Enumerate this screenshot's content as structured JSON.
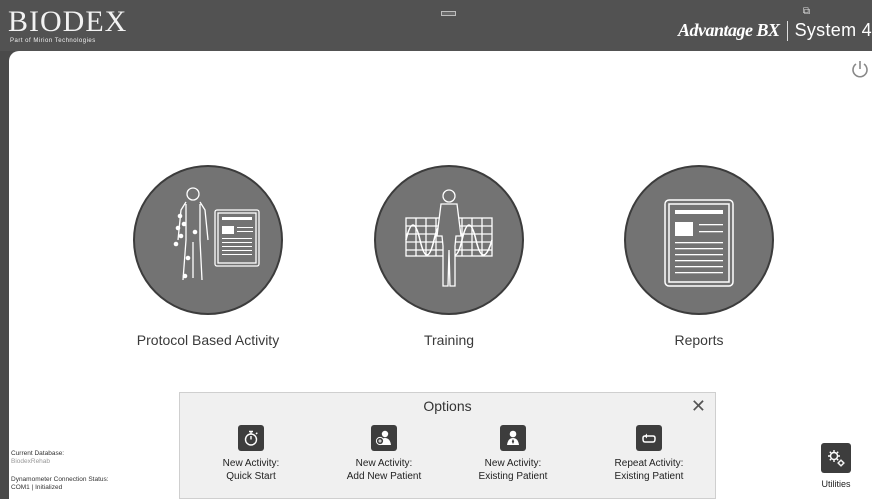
{
  "header": {
    "logo_main": "BIODEX",
    "logo_sub": "Part of Mirion Technologies",
    "brand": "Advantage BX",
    "system": "System 4"
  },
  "activities": [
    {
      "label": "Protocol Based Activity",
      "icon": "protocol-figure-icon"
    },
    {
      "label": "Training",
      "icon": "training-figure-icon"
    },
    {
      "label": "Reports",
      "icon": "report-document-icon"
    }
  ],
  "options": {
    "title": "Options",
    "items": [
      {
        "line1": "New Activity:",
        "line2": "Quick Start",
        "icon": "stopwatch-icon"
      },
      {
        "line1": "New Activity:",
        "line2": "Add New Patient",
        "icon": "add-patient-icon"
      },
      {
        "line1": "New Activity:",
        "line2": "Existing Patient",
        "icon": "patient-icon"
      },
      {
        "line1": "Repeat Activity:",
        "line2": "Existing Patient",
        "icon": "repeat-icon"
      }
    ]
  },
  "status": {
    "db_label": "Current Database:",
    "db_value": "BiodexRehab",
    "conn_label": "Dynamometer Connection Status:",
    "conn_value": "COM1 | Initialized"
  },
  "utilities": {
    "label": "Utilities",
    "icon": "gears-icon"
  },
  "colors": {
    "header_bg": "#525252",
    "circle_fill": "#737373",
    "icon_tile": "#3d3d3d",
    "page_bg": "#ffffff"
  }
}
